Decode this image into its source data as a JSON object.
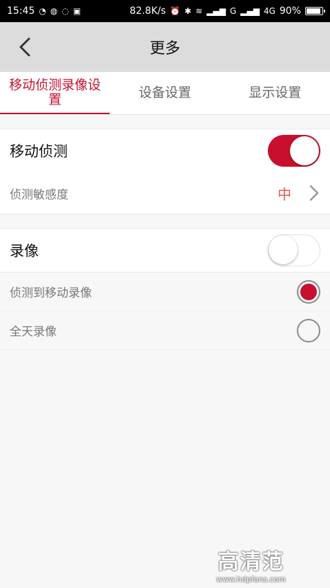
{
  "status_bar": {
    "time": "15:45",
    "speed": "82.8K/s",
    "network_g": "G",
    "network_4g": "4G",
    "battery": "90%"
  },
  "header": {
    "title": "更多"
  },
  "tabs": [
    {
      "label": "移动侦测录像设置",
      "active": true
    },
    {
      "label": "设备设置",
      "active": false
    },
    {
      "label": "显示设置",
      "active": false
    }
  ],
  "motion": {
    "label": "移动侦测",
    "toggle_on": true,
    "sensitivity_label": "侦测敏感度",
    "sensitivity_value": "中"
  },
  "recording": {
    "label": "录像",
    "toggle_on": false,
    "options": [
      {
        "label": "侦测到移动录像",
        "selected": true
      },
      {
        "label": "全天录像",
        "selected": false
      }
    ]
  },
  "watermark": {
    "brand": "高清范",
    "url": "www.hdpfans.com"
  },
  "colors": {
    "accent": "#c8102e",
    "sensitivity": "#e8574f"
  }
}
